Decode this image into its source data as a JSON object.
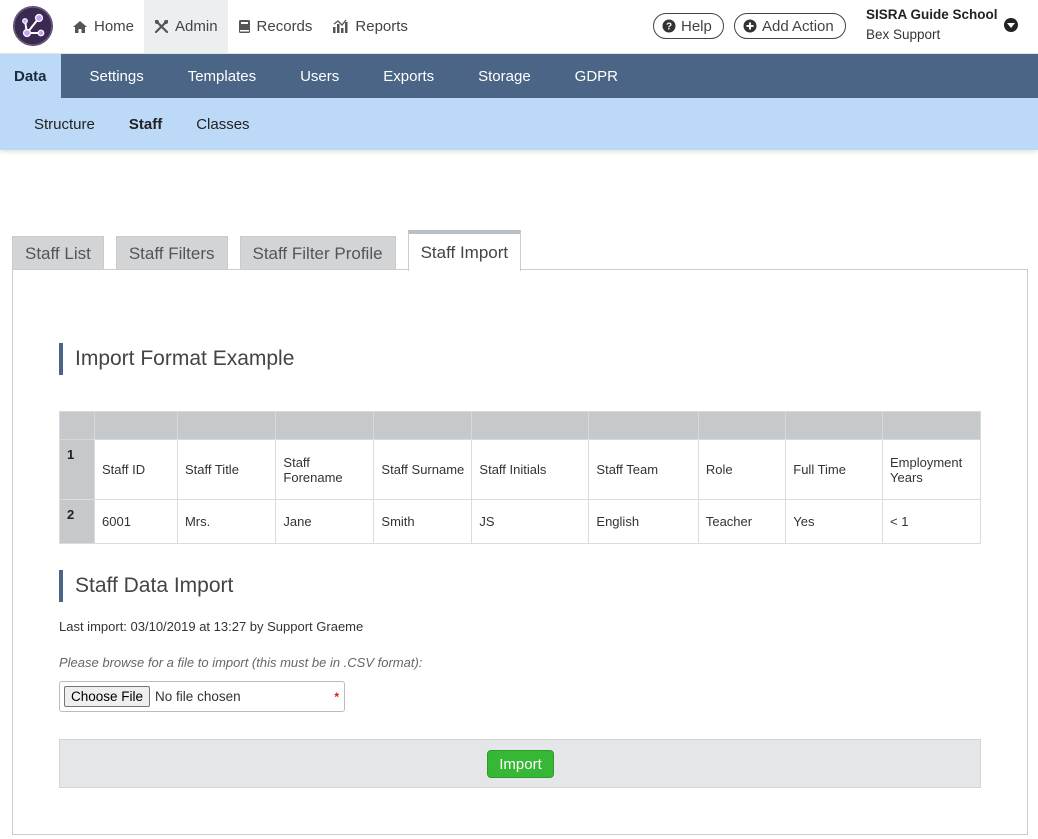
{
  "app": {
    "school_name": "SISRA Guide School",
    "user_name": "Bex Support"
  },
  "topnav": [
    {
      "label": "Home",
      "icon": "home-icon"
    },
    {
      "label": "Admin",
      "icon": "tools-icon",
      "active": true
    },
    {
      "label": "Records",
      "icon": "book-icon"
    },
    {
      "label": "Reports",
      "icon": "chart-icon"
    }
  ],
  "top_actions": {
    "help_label": "Help",
    "add_action_label": "Add Action"
  },
  "mainnav": [
    {
      "label": "Data",
      "active": true
    },
    {
      "label": "Settings"
    },
    {
      "label": "Templates"
    },
    {
      "label": "Users"
    },
    {
      "label": "Exports"
    },
    {
      "label": "Storage"
    },
    {
      "label": "GDPR"
    }
  ],
  "subnav": [
    {
      "label": "Structure"
    },
    {
      "label": "Staff",
      "active": true
    },
    {
      "label": "Classes"
    }
  ],
  "tabs": [
    {
      "label": "Staff List"
    },
    {
      "label": "Staff Filters"
    },
    {
      "label": "Staff Filter Profile"
    },
    {
      "label": "Staff Import",
      "active": true
    }
  ],
  "format_example": {
    "title": "Import Format Example",
    "rows": [
      {
        "num": "1",
        "cells": [
          "Staff ID",
          "Staff Title",
          "Staff Forename",
          "Staff Surname",
          "Staff Initials",
          "Staff Team",
          "Role",
          "Full Time",
          "Employment Years"
        ]
      },
      {
        "num": "2",
        "cells": [
          "6001",
          "Mrs.",
          "Jane",
          "Smith",
          "JS",
          "English",
          "Teacher",
          "Yes",
          "< 1"
        ]
      }
    ]
  },
  "data_import": {
    "title": "Staff Data Import",
    "last_import": "Last import: 03/10/2019 at 13:27 by Support Graeme",
    "browse_hint": "Please browse for a file to import (this must be in .CSV format):",
    "choose_file_label": "Choose File",
    "no_file_label": "No file chosen",
    "required_marker": "*",
    "import_label": "Import"
  },
  "colors": {
    "main_nav_bg": "#4a6585",
    "sub_nav_bg": "#bcdaf8",
    "import_button": "#36b736",
    "table_header_bg": "#c5c9cc"
  }
}
